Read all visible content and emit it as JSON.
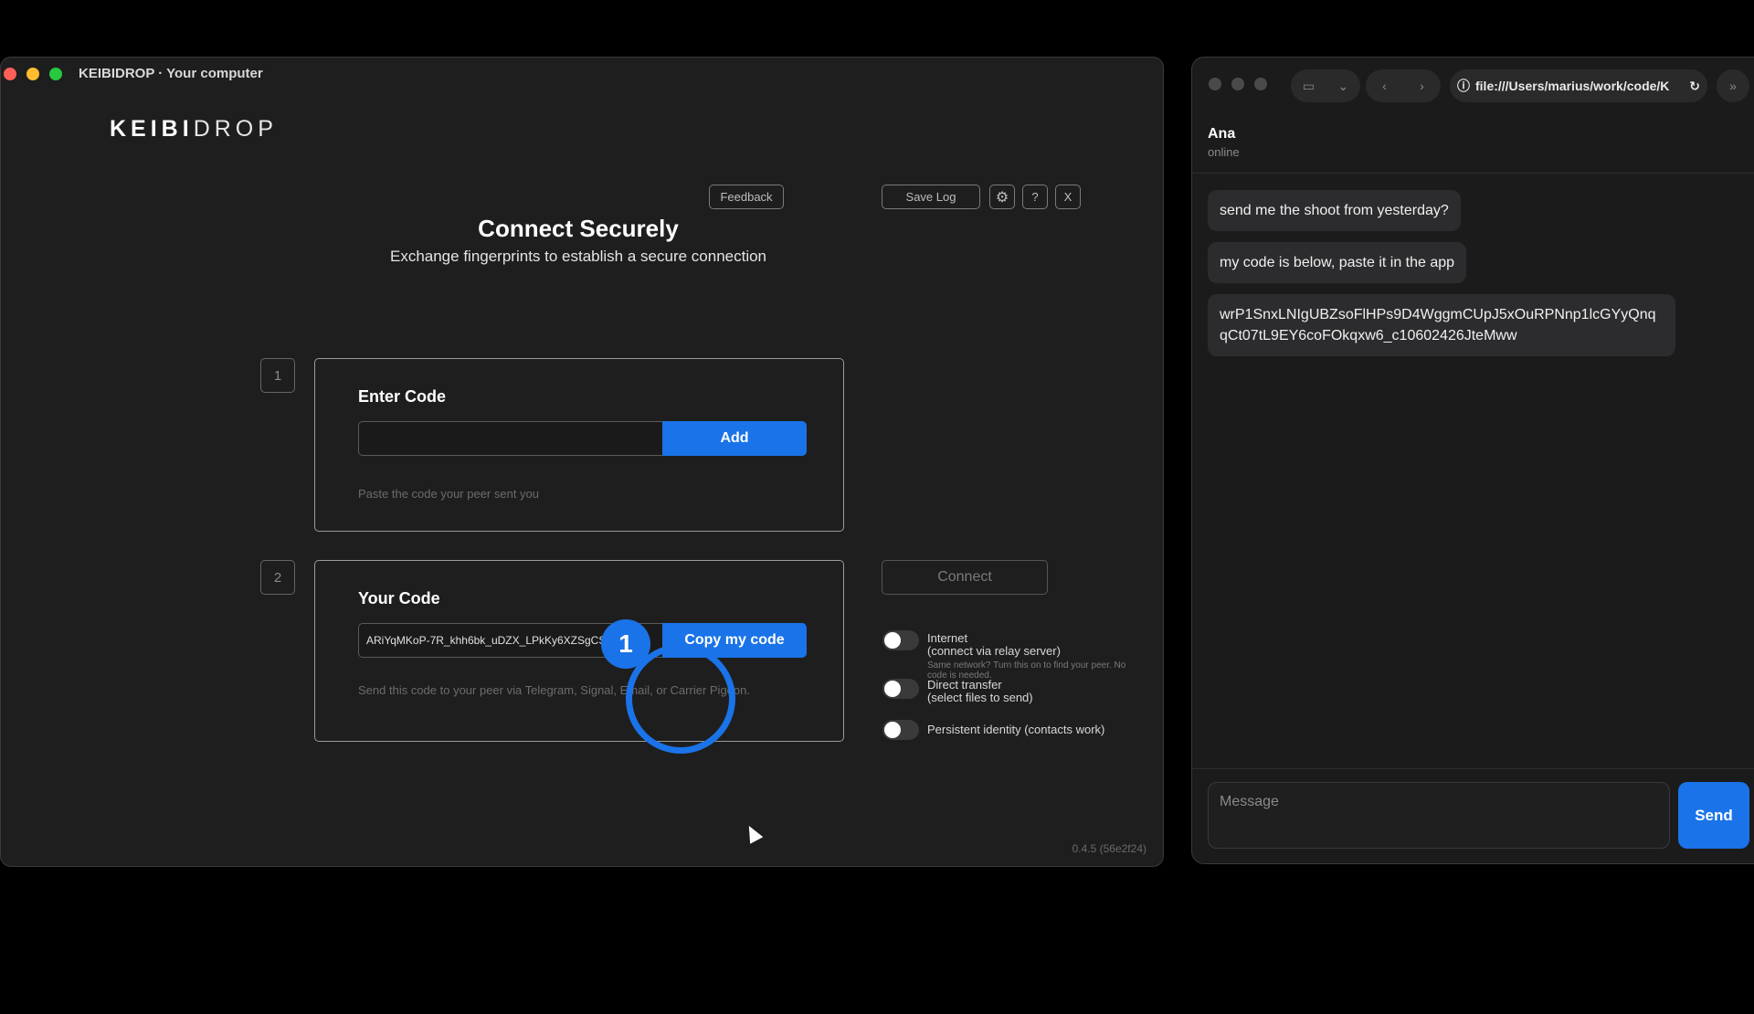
{
  "app": {
    "window_title": "KEIBIDROP · Your computer",
    "logo_bold": "KEIBI",
    "logo_light": "DROP",
    "buttons": {
      "feedback": "Feedback",
      "save_log": "Save Log",
      "settings_icon": "⚙",
      "help": "?",
      "close": "X"
    },
    "heading": "Connect Securely",
    "subheading": "Exchange fingerprints to establish a secure connection",
    "step1": {
      "number": "1",
      "title": "Enter Code",
      "input_value": "",
      "button": "Add",
      "hint": "Paste the code your peer sent you"
    },
    "step2": {
      "number": "2",
      "title": "Your Code",
      "code_value": "ARiYqMKoP-7R_khh6bk_uDZX_LPkKy6XZSgCSXJ3Gk...",
      "button": "Copy my code",
      "hint": "Send this code to your peer via Telegram, Signal, Email, or Carrier Pigeon."
    },
    "connect_button": "Connect",
    "options": [
      {
        "label_line1": "Internet",
        "label_line2": "(connect via relay server)",
        "note": "Same network? Turn this on to find your peer. No code is needed.",
        "enabled": false
      },
      {
        "label_line1": "Direct transfer",
        "label_line2": "(select files to send)",
        "enabled": false
      },
      {
        "label_line1": "Persistent identity (contacts work)",
        "enabled": false
      }
    ],
    "version": "0.4.5 (56e2f24)",
    "annotation_badge": "1",
    "accent_color": "#1a73e8"
  },
  "browser": {
    "url": "file:///Users/marius/work/code/K",
    "chat": {
      "contact_name": "Ana",
      "contact_status": "online",
      "messages": [
        "send me the shoot from yesterday?",
        "my code is below, paste it in the app",
        "wrP1SnxLNIgUBZsoFlHPs9D4WggmCUpJ5xOuRPNnp1lcGYyQnqqCt07tL9EY6coFOkqxw6_c10602426JteMww"
      ],
      "input_placeholder": "Message",
      "send_button": "Send"
    }
  }
}
